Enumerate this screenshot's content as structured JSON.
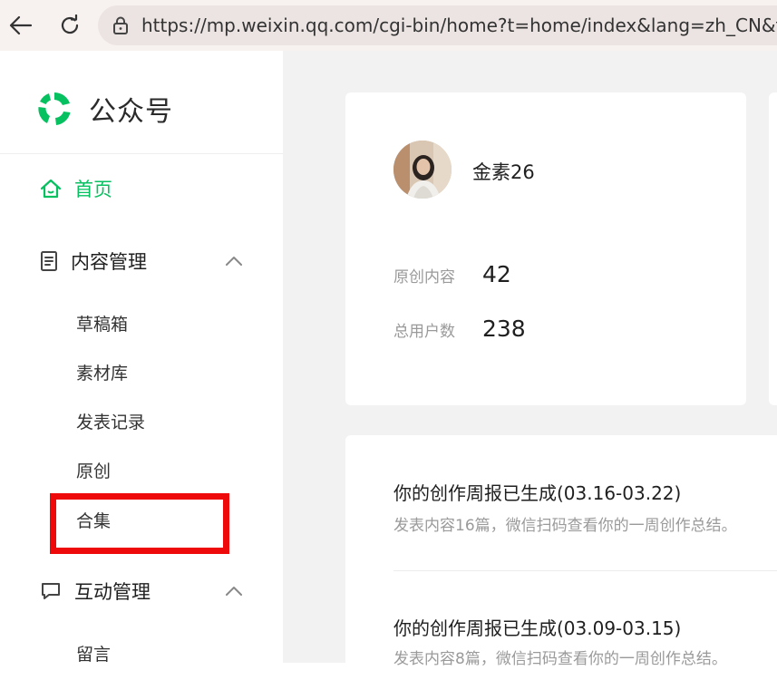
{
  "browser": {
    "url": "https://mp.weixin.qq.com/cgi-bin/home?t=home/index&lang=zh_CN&token="
  },
  "sidebar": {
    "logo_text": "公众号",
    "home_label": "首页",
    "content_mgmt_label": "内容管理",
    "content_items": [
      "草稿箱",
      "素材库",
      "发表记录",
      "原创",
      "合集"
    ],
    "interaction_mgmt_label": "互动管理",
    "interaction_items": [
      "留言"
    ]
  },
  "profile": {
    "name": "金素26",
    "stats": [
      {
        "label": "原创内容",
        "value": "42"
      },
      {
        "label": "总用户数",
        "value": "238"
      }
    ]
  },
  "news": [
    {
      "title": "你的创作周报已生成(03.16-03.22)",
      "subtitle": "发表内容16篇，微信扫码查看你的一周创作总结。"
    },
    {
      "title": "你的创作周报已生成(03.09-03.15)",
      "subtitle": "发表内容8篇，微信扫码查看你的一周创作总结。"
    }
  ],
  "colors": {
    "accent": "#07c160",
    "highlight": "#ee0a0a"
  }
}
